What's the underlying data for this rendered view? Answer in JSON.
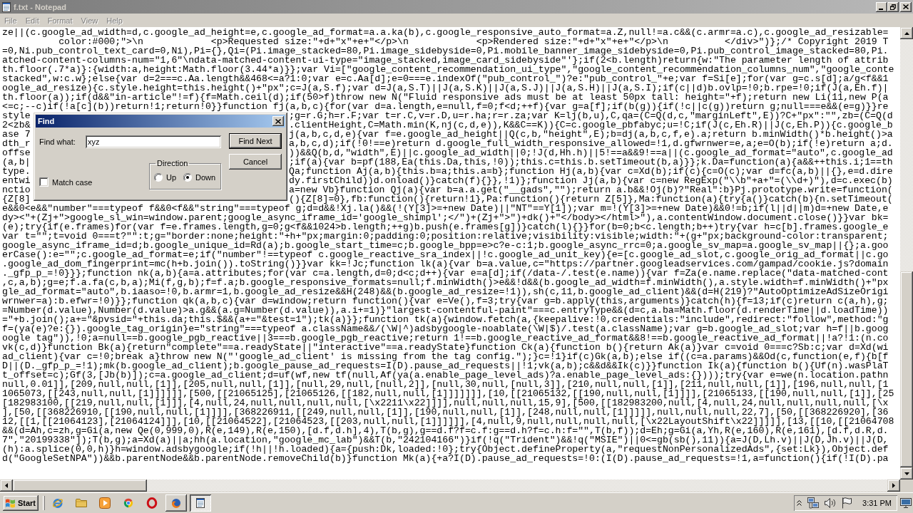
{
  "window": {
    "title": "f.txt - Notepad",
    "active": false
  },
  "menu": [
    {
      "label": "File",
      "disabled": true
    },
    {
      "label": "Edit",
      "disabled": true
    },
    {
      "label": "Format",
      "disabled": true
    },
    {
      "label": "View",
      "disabled": true
    },
    {
      "label": "Help",
      "disabled": true
    }
  ],
  "editor": {
    "lines": [
      {
        "kind": "full",
        "text": "ze||(c.google_ad_width=d,c.google_ad_height=e,c.google_ad_format=a.a.ka(b),c.google_responsive_auto_format=a.Z,null!=a.c&&(c.armr=a.c),c.google_ad_resizable="
      },
      {
        "kind": "full",
        "text": "          color:#000;\">\\n            <p>Requested size:\"+d+\"x\"+e+\"</p>\\n            <p>Rendered size:\"+d+\"x\"+e+\"</p>\\n          </div>\")};/* Copyright 2019 T"
      },
      {
        "kind": "full",
        "text": "=0,Ni.pub_control_text_card=0,Ni),Pi={},Qi=(Pi.image_stacked=80,Pi.image_sidebyside=0,Pi.mobile_banner_image_sidebyside=0,Pi.pub_control_image_stacked=80,Pi."
      },
      {
        "kind": "full",
        "text": "atched-content-columns-num=\"1,6\"\\ndata-matched-content-ui-type=\"image_stacked,image_card_sidebyside\"'};if(2<b.length)return{w:\"The parameter length of attrib"
      },
      {
        "kind": "full",
        "text": "th.floor(.7*a)}:{width:a,height:Math.floor(3.44*a)}};var Vi=[\"google_content_recommendation_ui_type\",\"google_content_recommendation_columns_num\",\"google_conte"
      },
      {
        "kind": "full",
        "text": "stacked\",w:c.w};else{var d=2===c.Aa.length&&468<=a?1:0;var e=c.Aa[d];e=0===e.indexOf(\"pub_control_\")?e:\"pub_control_\"+e;var f=Si[e];for(var g=c.s[d];a/g<f&&1"
      },
      {
        "kind": "full",
        "text": "oogle_ad_resize){c.style.height=this.height()+\"px\";c=J(a,S.f);var d=J(a,S.T)||J(a,S.K)||J(a,S.J)||J(a,S.H)||J(a,S.I);if(c||d)b.ovlp=!0;b.rpe=!0;if(J(a,Eh.f)|"
      },
      {
        "kind": "full",
        "text": "th.floor(a));if(d&&\"in-article\"!=f){f=Math.ceil(d);if(50>f)throw new N(\"Fluid responsive ads must be at least 50px tall: height=\"+f);return new Li(11,new P(a"
      },
      {
        "kind": "full",
        "text": "<=c;--c)if(!a[c](b))return!1;return!0}}function fj(a,b,c){for(var d=a.length,e=null,f=0;f<d;++f){var g=a[f];if(b(g)){if(!c||c(g))return g;null===e&&(e=g)}}re"
      },
      {
        "kind": "covered",
        "left": "style",
        "right": ";g=r.G;h=r.F;var t=r.C,v=r.D,u=r.ha;r=r.za;var K=lj(b,u),C,qa=(C=Q(d,c,\"marginLeft\",E))?C+\"px\":\"\",zb=(C=Q(d"
      },
      {
        "kind": "covered",
        "left": "2<zb&",
        "right": ".clientHeight,C=Math.min(K,nj(c,d,e)),K&&C==K)){C=c.google_pbfabyc;u=!C;if(J(c,Eh.R)||J(c,Eh.P)){c.google_b"
      },
      {
        "kind": "covered",
        "left": "ase 7",
        "right": "j(a,b,c,d,e){var f=e.google_ad_height||Q(c,b,\"height\",E);b=dj(a,b,c,f,e).a;return b.minWidth()*b.height()>a"
      },
      {
        "kind": "covered",
        "left": "dth_r",
        "right": "a,b,c,d);if(!0!==e)return d.google_full_width_responsive_allowed=!1,d.gfwrnwer=e,a;e=O(b);if(!e)return a;d."
      },
      {
        "kind": "covered",
        "left": "offse",
        "right": "))&&Q(b,d,\"width\",E)||c.google_ad_width||0;!J(d,Hh.h)||5!==a&&9!==a||(c.google_ad_format=\"auto\",c.google_ad"
      },
      {
        "kind": "covered",
        "left": "(a,b|",
        "right": ";if(a){var b=pf(188,Ea(this.Da,this,!0));this.c=this.b.setTimeout(b,a)}};k.Da=function(a){a&&++this.i;1==th"
      },
      {
        "kind": "covered",
        "left": "type.",
        "right": "Qa;function Aj(a,b){this.b=a;this.a=b};function Hj(a,b){var c=Xd(b);if(c){c=O(c);var d=fc(a,b)||{},e=d.dire"
      },
      {
        "kind": "covered",
        "left": "entwi",
        "right": "dy.firstChild))d.onload()}catch(f){}},!1)};function Jj(a,b){var c=new RegExp(\"\\\\b\"+a+\"=(\\\\d+)\"),d=c.exec(b)"
      },
      {
        "kind": "covered",
        "left": "nctio",
        "right": "a=new Vb}function Qj(a){var b=a.a.get(\"__gads\",\"\");return a.b&&!Oj(b)?\"Real\":b}Pj.prototype.write=function("
      },
      {
        "kind": "covered",
        "left": "{Z[8]",
        "right": "(){Z[8]=0},fb:function(){return!1},Pa:function(){return Z[5]},Ma:function(a){try{a()}catch(b){n.setTimeout("
      },
      {
        "kind": "full",
        "text": "e&&0<e&&\"number\"===typeof f&&0<f&&\"string\"===typeof g;d=d&&!Xj.la()&&(!(Y[3]>=+new Date)||\"NT\"==Y[1]);var m=!(Y[3]>=+new Date)&&0!=b;if(l||d||m)d=+new Date,e"
      },
      {
        "kind": "full",
        "text": "dy><\"+(Zj+\">google_sl_win=window.parent;google_async_iframe_id='google_shimpl';</\")+(Zj+\">\")+dk()+\"</body></html>\"),a.contentWindow.document.close()}}var bk="
      },
      {
        "kind": "full",
        "text": "(e);try{if(e.frames)for(var f=e.frames.length,g=0;g<f&&1024>b.length;++g)b.push(e.frames[g])}catch(l){}}for(b=0;b<c.length;b++)try{var h=c[b].frames.google_e"
      },
      {
        "kind": "full",
        "text": "var t=\"\";t=void 0===t?\"\":t;g=\"border:none;height:\"+h+\"px;margin:0;padding:0;position:relative;visibility:visible;width:\"+(g+\"px;background-color:transparent;"
      },
      {
        "kind": "full",
        "text": "google_async_iframe_id=d;b.google_unique_id=Rd(a);b.google_start_time=c;b.google_bpp=e>c?e-c:1;b.google_async_rrc=0;a.google_sv_map=a.google_sv_map||{};a.goo"
      },
      {
        "kind": "full",
        "text": "erCase():e=\"\";c.google_ad_format=e;if(\"number\"!==typeof c.google_reactive_sra_index||!c.google_ad_unit_key){e=[c.google_ad_slot,c.google_orig_ad_format||c.go"
      },
      {
        "kind": "full",
        "text": ".google_ad_dom_fingerprint=mc(h+b.join()).toString()}}var kk=!Jc;function lk(a){var b=a.value,c=\"https://partner.googleadservices.com/gampad/cookie.js?domain"
      },
      {
        "kind": "full",
        "text": "._gfp_p_=!0}}};function nk(a,b){a=a.attributes;for(var c=a.length,d=0;d<c;d++){var e=a[d];if(/data-/.test(e.name)){var f=Za(e.name.replace(\"data-matched-cont"
      },
      {
        "kind": "full",
        "text": ",c,a,b);g=e;f.a.fa(c,b,a);Mi(f,g,b);f=f.a;b.google_responsive_formats=null;f.minWidth()>e&&!d&&(b.google_ad_width=f.minWidth(),a.style.width=f.minWidth()+\"px"
      },
      {
        "kind": "full",
        "text": "gle_ad_format=\"auto\",b.iaaso=!0,b.armr=1,b.google_ad_resize&&H(248)&&(b.google_ad_resize=!1)),sh(c,11,b.google_ad_client)&&(d=H(219)?\"AutoOptimizeAdSizeOrigi"
      },
      {
        "kind": "full",
        "text": "wrnwer=a):b.efwr=!0)}};function qk(a,b,c){var d=window;return function(){var e=Ve(),f=3;try{var g=b.apply(this,arguments)}catch(h){f=13;if(c)return c(a,h),g;"
      },
      {
        "kind": "full",
        "text": "=Number(d.value),Number(d.value)>a.g&&(a.g=Number(d.value)),a.i+=1)}\"largest-contentful-paint\"===c.entryType&&(d=c,a.ba=Math.floor(d.renderTime||d.loadTime))"
      },
      {
        "kind": "full",
        "text": "=\"+b.join();a+=\"&pvsid=\"+this.da;this.$&&(a+=\"&test=1\");tk(a)}};function tk(a){window.fetch(a,{keepalive:!0,credentials:\"include\",redirect:\"follow\",method:\"g"
      },
      {
        "kind": "full",
        "text": "f=(ya(e)?e:{}).google_tag_origin}e=\"string\"===typeof a.className&&/(\\W|^)adsbygoogle-noablate(\\W|$)/.test(a.className);var g=b.google_ad_slot;var h=f||b.goog"
      },
      {
        "kind": "full",
        "text": "oogle tag\")),!0;a=null==b.google_pgb_reactive||3===b.google_pgb_reactive;return 1!==b.google_reactive_ad_format&&8!==b.google_reactive_ad_format||!a?!1:(n.co"
      },
      {
        "kind": "full",
        "text": "vk(c,d)}function Bk(a){return\"complete\"==a.readyState||\"interactive\"==a.readyState}function Ck(a){function b(){return Ak(a)}var c=void 0===c?Sb:c;var d=Xd(wi"
      },
      {
        "kind": "full",
        "text": "ad_client){var c=!0;break a}throw new N(\"'google_ad_client' is missing from the tag config.\");}c=!1}if(c)Gk(a,b);else if((c=a.params)&&Od(c,function(e,f){b[f"
      },
      {
        "kind": "full",
        "text": "D||(D._gfp_p_=!1);mk(b.google_ad_client);b.google_pause_ad_requests=I(D).pause_ad_requests||!1;vk(a,b);c&&d&&Ik(c)}}function Ik(a){function b(){Uf(n).wasPlaT"
      },
      {
        "kind": "full",
        "text": "t_offset=c);Gf(3,[Jb(b)]);c=a.google_ad_client;d=uf(wf,new tf(null,Af(ya(a.enable_page_level_ads)?a.enable_page_level_ads:{})));try{var e=we(n.location.pathn"
      },
      {
        "kind": "full",
        "text": "null,0.01]],[209,null,null,[1]],[205,null,null,[1]],[null,29,null,[null,2]],[null,30,null,[null,3]],[210,null,null,[1]],[211,null,null,[1]],[196,null,null,[1"
      },
      {
        "kind": "full",
        "text": "1065073,[[243,null,null,[1]]]]]],[500,[[21065125],[21065126,[[182,null,null,[1]]]]]]],[10,[[21065132,[[190,null,null,[1]]]],[21065133,[[190,null,null,[1]],[25"
      },
      {
        "kind": "full",
        "text": "[182983100,[[219,null,null,[1]]],[4,null,24,null,null,null,null,[\\x2211\\x22]]]],null,null,null,15,9],[500,[[182983200,null,[4,null,24,null,null,null,null,[\\x"
      },
      {
        "kind": "full",
        "text": "],[50,[[368226910,[[190,null,null,[1]]]],[368226911,[[249,null,null,[1]],[190,null,null,[1]],[248,null,null,[1]]]]],null,null,null,22,7],[50,[[368226920],[36"
      },
      {
        "kind": "full",
        "text": "12,[[1,[[21064123],[21064124]]],[10,[[21064522],[21064523,[[203,null,null,[1]]]]]],[4,null,9,null,null,null,null,[\\x22LayoutShift\\x22]]]]],[13,[[10,[[21064708"
      },
      {
        "kind": "full",
        "text": "&&(d=Ah,c=zh,g=Gi(a,new Qe(0,999,0),R(e,149),R(e,150),[d.f,d.h],4),T(b,g),g==d.f?f=c.f:g==d.h?f=c.h:f=\"\",T(b,f));d=Eh;g=Gi(a,Yh,R(e,160),R(e,161),[d.f,d.R,d."
      },
      {
        "kind": "full",
        "text": "7\",\"20199338\"]);T(b,g);a=Xd(a)||a;hh(a.location,\"google_mc_lab\")&&T(b,\"242104166\")}if(!q(\"Trident\")&&!q(\"MSIE\")||0<=gb(sb(),11)){a=J(D,Lh.v)||J(D,Jh.v)||J(D,"
      },
      {
        "kind": "full",
        "text": "(h):a.splice(0,0,h)}h=window.adsbygoogle;if(!h||!h.loaded){a={push:Dk,loaded:!0};try{Object.defineProperty(a,\"requestNonPersonalizedAds\",{set:Lk}),Object.def"
      },
      {
        "kind": "full",
        "text": "d(\"GoogleSetNPA\"))&&b.parentNode&&b.parentNode.removeChild(b)}function Mk(a){+a?I(D).pause_ad_requests=!0:(I(D).pause_ad_requests=!1,a=function(){if(!I(D).pa"
      }
    ]
  },
  "find_dialog": {
    "title": "Find",
    "find_what": {
      "label": "Find what:",
      "value": "xyz"
    },
    "match_case": {
      "label": "Match case",
      "checked": false
    },
    "direction": {
      "label": "Direction",
      "options": [
        {
          "label": "Up",
          "selected": false
        },
        {
          "label": "Down",
          "selected": true
        }
      ]
    },
    "buttons": [
      {
        "label": "Find Next",
        "default": true
      },
      {
        "label": "Cancel",
        "default": false
      }
    ]
  },
  "taskbar": {
    "start": "Start",
    "tasks": [
      {
        "kind": "browser",
        "selected": false
      },
      {
        "kind": "notepad",
        "selected": true
      }
    ],
    "clock": "3:31 PM"
  }
}
